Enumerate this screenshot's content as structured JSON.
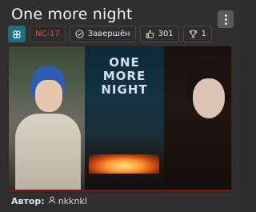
{
  "title": "One more night",
  "badges": {
    "rating": "NC-17",
    "status": "Завершён",
    "likes": "301",
    "awards": "1"
  },
  "cover": {
    "title_lines": [
      "ONE",
      "MORE",
      "NIGHT"
    ]
  },
  "author": {
    "label": "Автор:",
    "name": "nkknkl"
  },
  "colors": {
    "focus_badge": "#1f6f80",
    "rating": "#d8553a",
    "background": "#2f2f2f"
  },
  "icons": {
    "focus": "focus-icon",
    "status": "checkmark-circle-icon",
    "likes": "thumbs-up-icon",
    "awards": "trophy-icon",
    "author": "user-icon",
    "menu": "kebab-menu-icon"
  }
}
